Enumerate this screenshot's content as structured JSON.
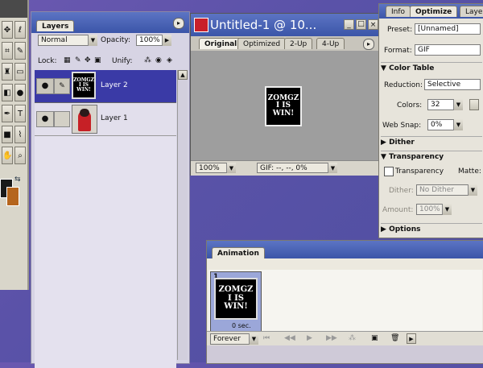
{
  "tools_palette": {
    "icons": [
      "move-icon",
      "lasso-icon",
      "crop-icon",
      "brush-icon",
      "stamp-icon",
      "eraser-icon",
      "gradient-icon",
      "dodge-icon",
      "pen-icon",
      "text-icon",
      "shape-icon",
      "eyedropper-icon",
      "hand-icon",
      "zoom-icon"
    ]
  },
  "layers_panel": {
    "tab_label": "Layers",
    "blend_mode": "Normal",
    "opacity_label": "Opacity:",
    "opacity_value": "100%",
    "lock_label": "Lock:",
    "unify_label": "Unify:",
    "layers": [
      {
        "name": "Layer 2",
        "selected": true
      },
      {
        "name": "Layer 1",
        "selected": false
      }
    ]
  },
  "document_window": {
    "title": "Untitled-1 @ 10...",
    "tabs": [
      "Original",
      "Optimized",
      "2-Up",
      "4-Up"
    ],
    "active_tab": "Original",
    "zoom": "100%",
    "status": "GIF: --, --, 0%"
  },
  "artwork": {
    "lines": [
      "ZOMGZ",
      "I IS",
      "WIN!"
    ]
  },
  "optimize_panel": {
    "tabs": [
      "Info",
      "Optimize",
      "Layer"
    ],
    "active_tab": "Optimize",
    "preset_label": "Preset:",
    "preset_value": "[Unnamed]",
    "format_label": "Format:",
    "format_value": "GIF",
    "color_table_label": "Color Table",
    "reduction_label": "Reduction:",
    "reduction_value": "Selective",
    "colors_label": "Colors:",
    "colors_value": "32",
    "web_snap_label": "Web Snap:",
    "web_snap_value": "0%",
    "dither_section_label": "Dither",
    "transparency_section_label": "Transparency",
    "transparency_checkbox_label": "Transparency",
    "matte_label": "Matte:",
    "dither_label": "Dither:",
    "dither_value": "No Dither",
    "amount_label": "Amount:",
    "amount_value": "100%",
    "options_label": "Options"
  },
  "animation_panel": {
    "tab_label": "Animation",
    "frame_number": "1",
    "frame_delay": "0 sec.",
    "loop_value": "Forever"
  },
  "colors": {
    "foreground": "#1a1a1a",
    "background": "#b5651d",
    "selection": "#3a3aa6",
    "panel_face": "#ece9df"
  }
}
